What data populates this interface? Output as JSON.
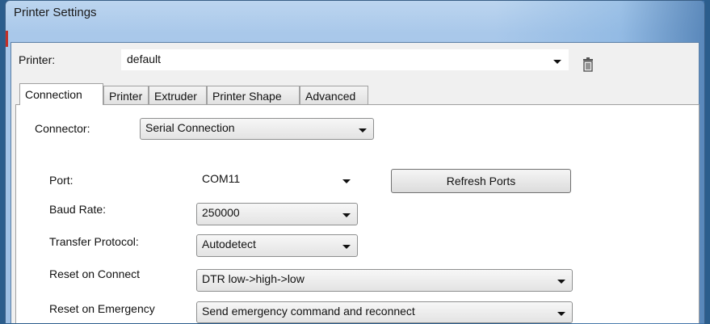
{
  "window": {
    "title": "Printer Settings"
  },
  "printer_select": {
    "label": "Printer:",
    "value": "default",
    "delete_icon": "trash-icon"
  },
  "tabs": [
    {
      "label": "Connection",
      "active": true
    },
    {
      "label": "Printer",
      "active": false
    },
    {
      "label": "Extruder",
      "active": false
    },
    {
      "label": "Printer Shape",
      "active": false
    },
    {
      "label": "Advanced",
      "active": false
    }
  ],
  "connection": {
    "connector_label": "Connector:",
    "connector_value": "Serial Connection",
    "port_label": "Port:",
    "port_value": "COM11",
    "refresh_label": "Refresh Ports",
    "baud_label": "Baud Rate:",
    "baud_value": "250000",
    "protocol_label": "Transfer Protocol:",
    "protocol_value": "Autodetect",
    "reset_connect_label": "Reset on Connect",
    "reset_connect_value": "DTR low->high->low",
    "reset_emergency_label": "Reset on Emergency",
    "reset_emergency_value": "Send emergency command and reconnect"
  },
  "colors": {
    "accent": "#c43028",
    "frame": "#9dbfe4"
  }
}
